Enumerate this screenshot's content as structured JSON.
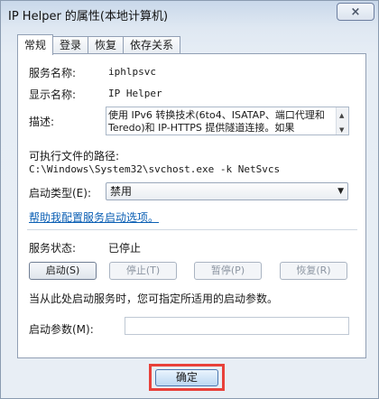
{
  "window": {
    "title": "IP Helper 的属性(本地计算机)"
  },
  "close_icon": "×",
  "tabs": [
    "常规",
    "登录",
    "恢复",
    "依存关系"
  ],
  "general": {
    "service_name_label": "服务名称:",
    "service_name_value": "iphlpsvc",
    "display_name_label": "显示名称:",
    "display_name_value": "IP Helper",
    "description_label": "描述:",
    "description_value": "使用 IPv6 转换技术(6to4、ISATAP、端口代理和 Teredo)和 IP-HTTPS 提供隧道连接。如果",
    "exec_path_label": "可执行文件的路径:",
    "exec_path_value": "C:\\Windows\\System32\\svchost.exe -k NetSvcs",
    "startup_type_label": "启动类型(E):",
    "startup_type_value": "禁用",
    "help_link": "帮助我配置服务启动选项。",
    "service_status_label": "服务状态:",
    "service_status_value": "已停止",
    "buttons": {
      "start": "启动(S)",
      "stop": "停止(T)",
      "pause": "暂停(P)",
      "resume": "恢复(R)"
    },
    "start_hint": "当从此处启动服务时，您可指定所适用的启动参数。",
    "start_params_label": "启动参数(M):",
    "start_params_value": ""
  },
  "footer": {
    "ok": "确定"
  },
  "colors": {
    "highlight": "#e8413a",
    "link": "#0b5fb4"
  }
}
